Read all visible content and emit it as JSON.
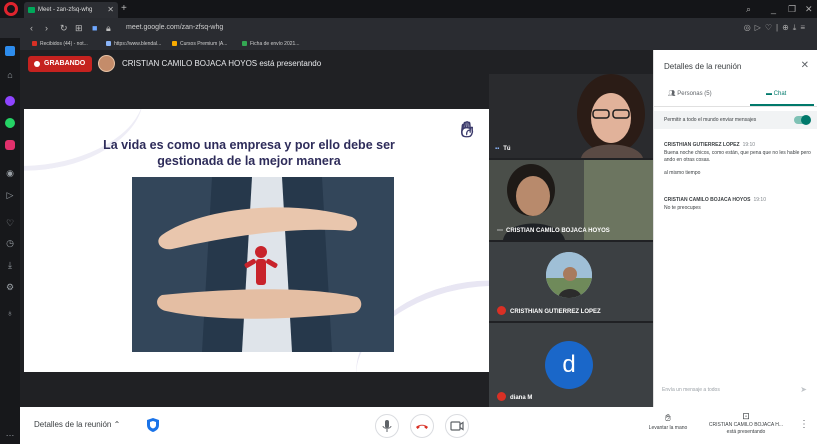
{
  "browser": {
    "tab_title": "Meet - zan-zfsq-whg",
    "url": "meet.google.com/zan-zfsq-whg",
    "bookmarks": [
      "Recibidos (44) - not...",
      "https://www.blendal...",
      "Cursos Premium |A...",
      "Ficha de envío 2021..."
    ],
    "accent": "#e0242e"
  },
  "meet": {
    "recording_label": "GRABANDO",
    "presenter_text": "CRISTIAN CAMILO BOJACA HOYOS está presentando",
    "slide_title": "La vida es como una empresa y por ello debe ser gestionada de la mejor manera",
    "tiles": [
      {
        "name": "Tú"
      },
      {
        "name": "CRISTIAN CAMILO BOJACA HOYOS"
      },
      {
        "name": "CRISTHIAN GUTIERREZ LOPEZ"
      },
      {
        "name": "diana M",
        "initial": "d"
      }
    ],
    "colors": {
      "recording": "#c5221f",
      "mic_off": "#d93025",
      "avatar_d": "#1a67c9"
    }
  },
  "bottombar": {
    "meeting_details": "Detalles de la reunión",
    "raise_hand": "Levantar la mano",
    "present_line1": "CRISTIAN CAMILO BOJACA H...",
    "present_line2": "está presentando"
  },
  "panel": {
    "title": "Detalles de la reunión",
    "tab_people": "Personas (5)",
    "tab_chat": "Chat",
    "allow_messages": "Permitir a todo el mundo enviar mensajes",
    "messages": [
      {
        "sender": "CRISTHIAN GUTIERREZ LOPEZ",
        "time": "19:10",
        "lines": [
          "Buena noche chicos, como están, que pena que no les hable pero ando en otras cosas.",
          "al mismo tiempo"
        ]
      },
      {
        "sender": "CRISTIAN CAMILO BOJACA HOYOS",
        "time": "19:10",
        "lines": [
          "No te preocupes"
        ]
      }
    ],
    "input_placeholder": "Envía un mensaje a todos",
    "accent": "#00796b"
  }
}
